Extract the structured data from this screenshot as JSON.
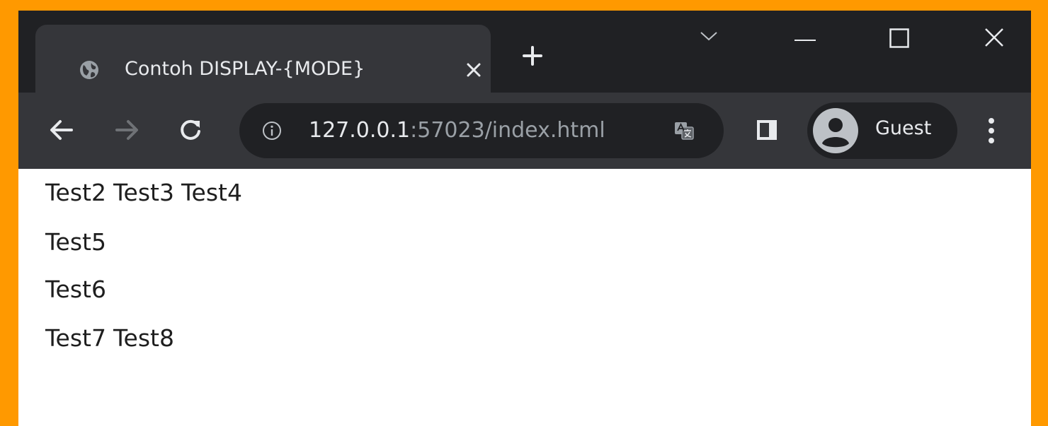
{
  "tab": {
    "title": "Contoh DISPLAY-{MODE}",
    "favicon": "globe-icon",
    "close_icon": "close-icon"
  },
  "new_tab_icon": "plus-icon",
  "window_controls": [
    "chevron-down-icon",
    "minimize-icon",
    "maximize-icon",
    "close-icon"
  ],
  "toolbar": {
    "url_host": "127.0.0.1",
    "url_rest": ":57023/index.html",
    "profile_label": "Guest"
  },
  "content": {
    "line1": [
      "Test2",
      "Test3",
      "Test4"
    ],
    "line2": [
      "Test5"
    ],
    "line3": [
      "Test6"
    ],
    "line4": [
      "Test7",
      "Test8"
    ]
  },
  "colors": {
    "frame_background": "#FF9900",
    "tabstrip": "#202124",
    "toolbar": "#35363a",
    "text_light": "#e8eaed",
    "text_dim": "#9aa0a6"
  }
}
